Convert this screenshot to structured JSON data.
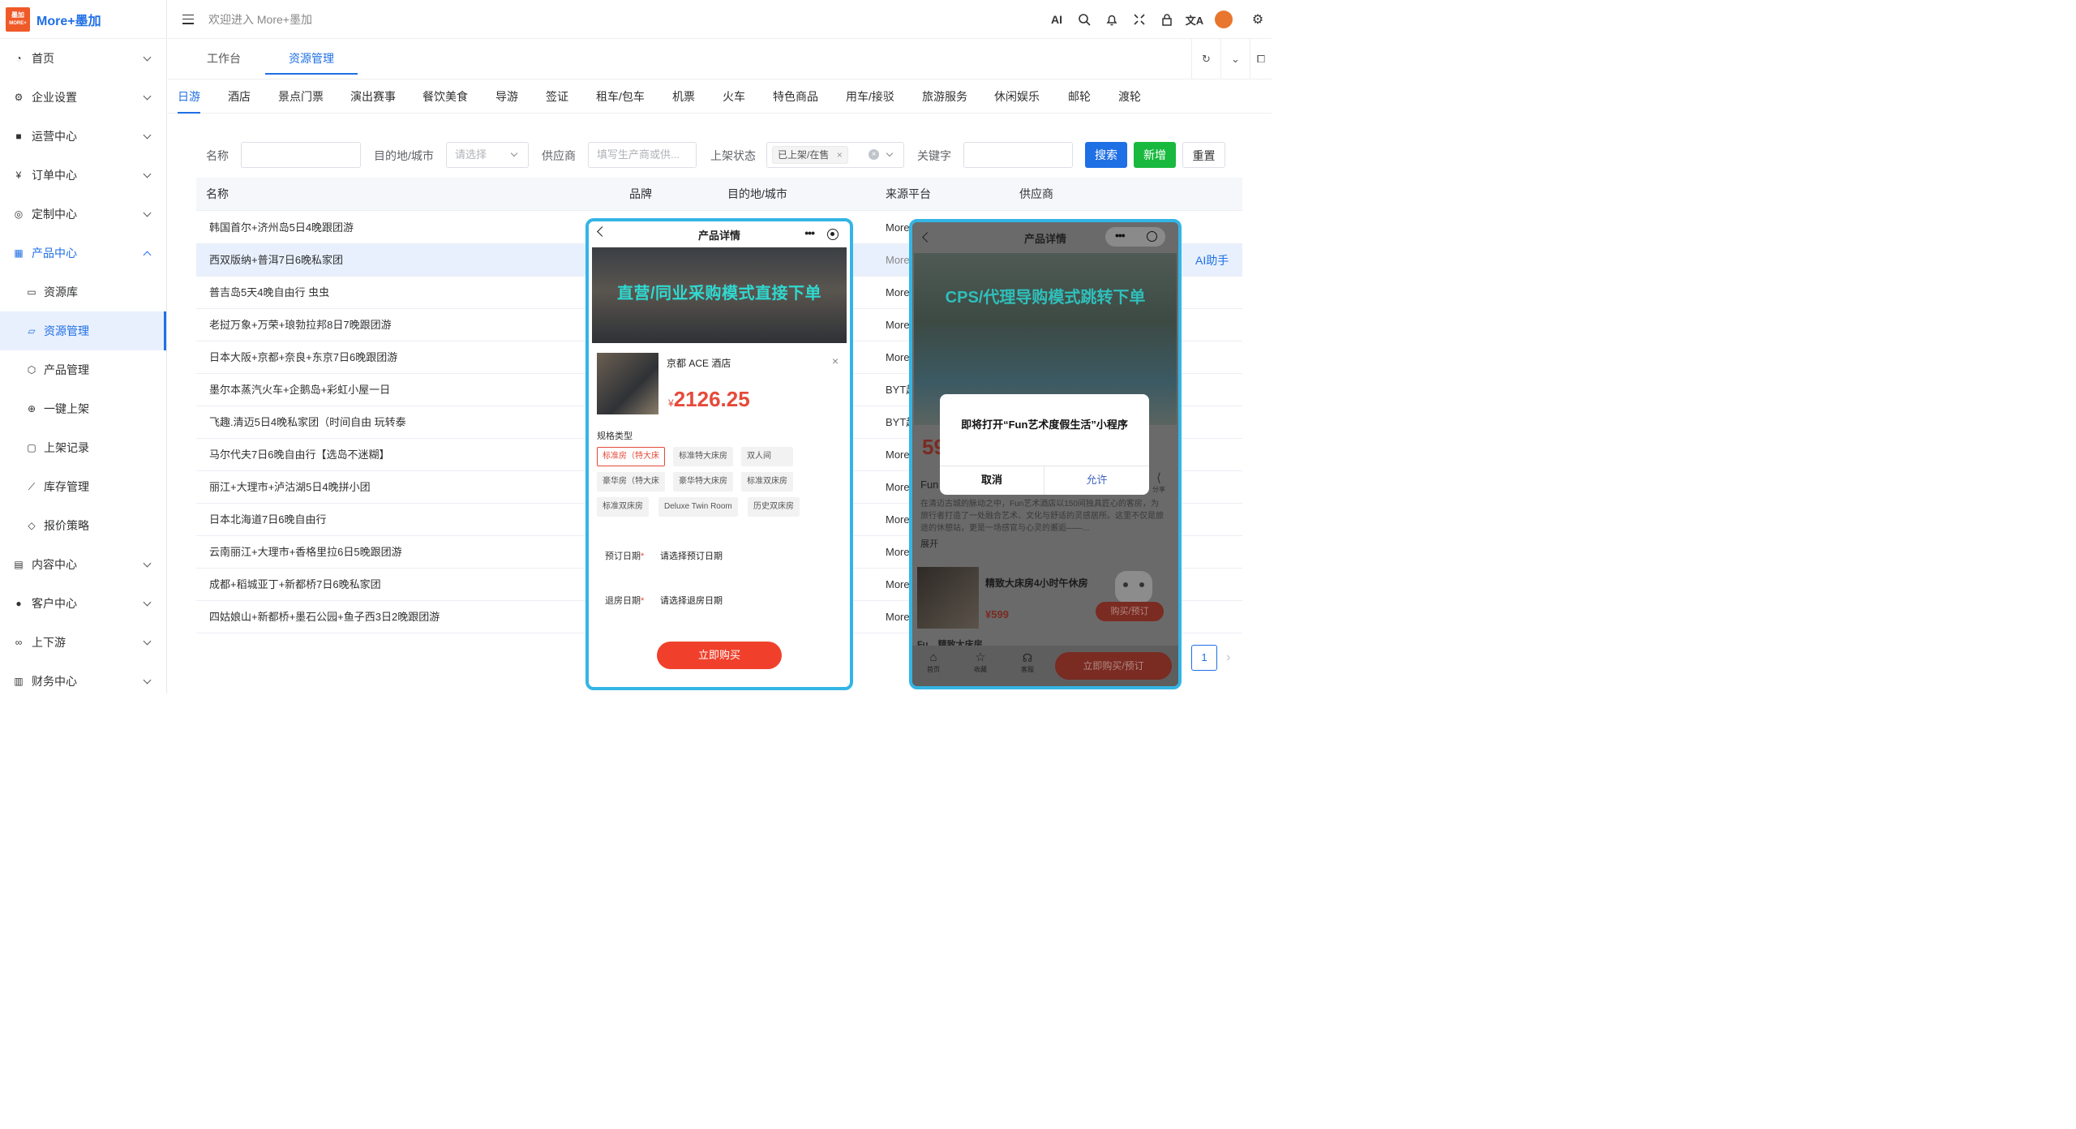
{
  "logo": {
    "mark_line1": "墨加",
    "mark_line2": "MORE+",
    "name": "More+墨加"
  },
  "header": {
    "welcome": "欢迎进入 More+墨加",
    "ai_label": "AI"
  },
  "sidebar": {
    "items": [
      {
        "label": "首页",
        "icon": "dashboard-icon"
      },
      {
        "label": "企业设置",
        "icon": "gear-icon"
      },
      {
        "label": "运营中心",
        "icon": "android-icon"
      },
      {
        "label": "订单中心",
        "icon": "order-icon"
      },
      {
        "label": "定制中心",
        "icon": "compass-icon"
      },
      {
        "label": "产品中心",
        "icon": "grid-icon"
      }
    ],
    "sub_items": [
      {
        "label": "资源库",
        "icon": "folder-icon"
      },
      {
        "label": "资源管理",
        "icon": "folder-open-icon"
      },
      {
        "label": "产品管理",
        "icon": "box-icon"
      },
      {
        "label": "一键上架",
        "icon": "target-icon"
      },
      {
        "label": "上架记录",
        "icon": "bag-icon"
      },
      {
        "label": "库存管理",
        "icon": "trend-icon"
      },
      {
        "label": "报价策略",
        "icon": "tag-icon"
      }
    ],
    "items_after": [
      {
        "label": "内容中心",
        "icon": "doc-icon"
      },
      {
        "label": "客户中心",
        "icon": "wechat-icon"
      },
      {
        "label": "上下游",
        "icon": "link-icon"
      },
      {
        "label": "财务中心",
        "icon": "receipt-icon"
      }
    ]
  },
  "page_tabs": [
    "工作台",
    "资源管理"
  ],
  "categories": [
    "日游",
    "酒店",
    "景点门票",
    "演出赛事",
    "餐饮美食",
    "导游",
    "签证",
    "租车/包车",
    "机票",
    "火车",
    "特色商品",
    "用车/接驳",
    "旅游服务",
    "休闲娱乐",
    "邮轮",
    "渡轮"
  ],
  "filters": {
    "name_label": "名称",
    "dest_label": "目的地/城市",
    "dest_placeholder": "请选择",
    "supplier_label": "供应商",
    "supplier_placeholder": "填写生产商或供...",
    "status_label": "上架状态",
    "status_tag": "已上架/在售",
    "keyword_label": "关键字",
    "search": "搜索",
    "add": "新增",
    "reset": "重置"
  },
  "table": {
    "headers": [
      "名称",
      "品牌",
      "目的地/城市",
      "来源平台",
      "供应商"
    ],
    "rows": [
      {
        "name": "韩国首尔+济州岛5日4晚跟团游",
        "source": "More"
      },
      {
        "name": "西双版纳+普洱7日6晚私家团",
        "source": "More"
      },
      {
        "name": "普吉岛5天4晚自由行 虫虫",
        "source": "More"
      },
      {
        "name": "老挝万象+万荣+琅勃拉邦8日7晚跟团游",
        "source": "More"
      },
      {
        "name": "日本大阪+京都+奈良+东京7日6晚跟团游",
        "source": "More"
      },
      {
        "name": "墨尔本蒸汽火车+企鹅岛+彩虹小屋一日",
        "source": "BYT起"
      },
      {
        "name": "飞趣.清迈5日4晚私家团（时间自由 玩转泰",
        "source": "BYT起"
      },
      {
        "name": "马尔代夫7日6晚自由行【选岛不迷糊】",
        "source": "More"
      },
      {
        "name": "丽江+大理市+泸沽湖5日4晚拼小团",
        "source": "More"
      },
      {
        "name": "日本北海道7日6晚自由行",
        "source": "More"
      },
      {
        "name": "云南丽江+大理市+香格里拉6日5晚跟团游",
        "source": "More"
      },
      {
        "name": "成都+稻城亚丁+新都桥7日6晚私家团",
        "source": "More"
      },
      {
        "name": "四姑娘山+新都桥+墨石公园+鱼子西3日2晚跟团游",
        "source": "More"
      }
    ],
    "ai_helper": "AI助手",
    "page": "1"
  },
  "phone1": {
    "title": "产品详情",
    "banner": "直营/同业采购模式直接下单",
    "hotel": "京都 ACE 酒店",
    "currency": "¥",
    "price": "2126.25",
    "spec_label": "规格类型",
    "specs": [
      "标准房（特大床",
      "标准特大床房",
      "双人间",
      "豪华房（特大床",
      "豪华特大床房",
      "标准双床房",
      "标准双床房",
      "Deluxe Twin Room",
      "历史双床房"
    ],
    "checkin_label": "预订日期",
    "checkin_value": "请选择预订日期",
    "checkout_label": "退房日期",
    "checkout_value": "请选择退房日期",
    "buy": "立即购买"
  },
  "phone2": {
    "title": "产品详情",
    "banner": "CPS/代理导购模式跳转下单",
    "dialog_text": "即将打开“Fun艺术度假生活”小程序",
    "cancel": "取消",
    "allow": "允许",
    "price_frag": "59",
    "fun_frag": "Fun",
    "share": "分享",
    "desc": "在清迈古城的脉动之中，Fun艺术酒店以150间独具匠心的客房，为旅行者打造了一处融合艺术、文化与舒适的灵感居所。这里不仅是旅途的休憩站，更是一场感官与心灵的邂逅——...",
    "expand": "展开",
    "room_name": "精致大床房4小时午休房",
    "room_price": "¥599",
    "book": "购买/预订",
    "nav": [
      "首页",
      "收藏",
      "客服"
    ],
    "buy": "立即购买/预订",
    "next_room": "Fu... 精致大床房"
  }
}
